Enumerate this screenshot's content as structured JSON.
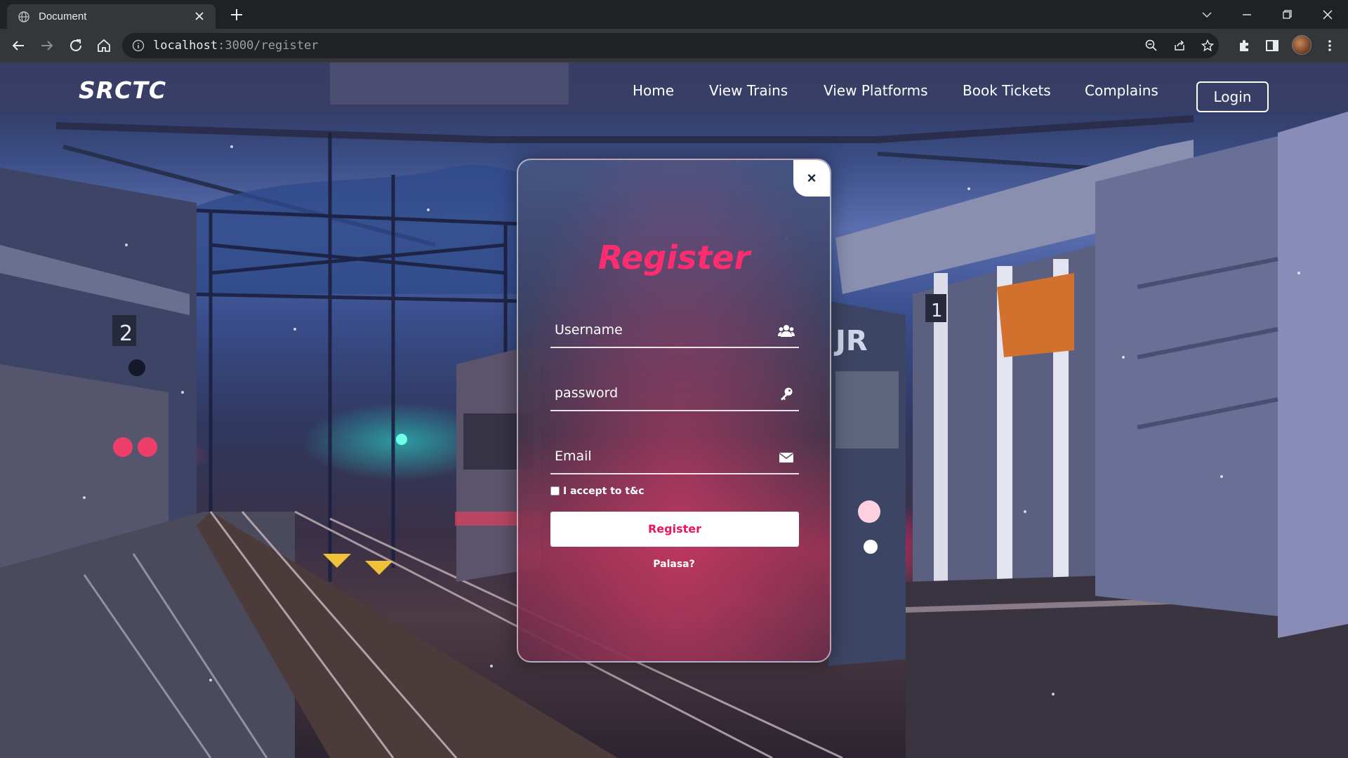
{
  "browser": {
    "tab_title": "Document",
    "url_host": "localhost",
    "url_path": ":3000/register",
    "icons": [
      "globe-icon",
      "close-icon",
      "plus-icon",
      "chevron-down-icon",
      "minimize-icon",
      "restore-icon",
      "window-close-icon",
      "back-icon",
      "forward-icon",
      "reload-icon",
      "home-icon",
      "info-icon",
      "zoom-icon",
      "share-icon",
      "star-icon",
      "extensions-icon",
      "side-panel-icon",
      "menu-icon"
    ]
  },
  "site": {
    "brand": "SRCTC",
    "nav": {
      "home": "Home",
      "view_trains": "View Trains",
      "view_platforms": "View Platforms",
      "book_tickets": "Book Tickets",
      "complains": "Complains",
      "login": "Login"
    }
  },
  "modal": {
    "close_glyph": "×",
    "title": "Register",
    "fields": {
      "username_placeholder": "Username",
      "password_placeholder": "password",
      "email_placeholder": "Email"
    },
    "terms_label": "I accept to t&c",
    "submit_label": "Register",
    "alt_link": "Palasa?",
    "accent_color": "#ff2d6f"
  }
}
